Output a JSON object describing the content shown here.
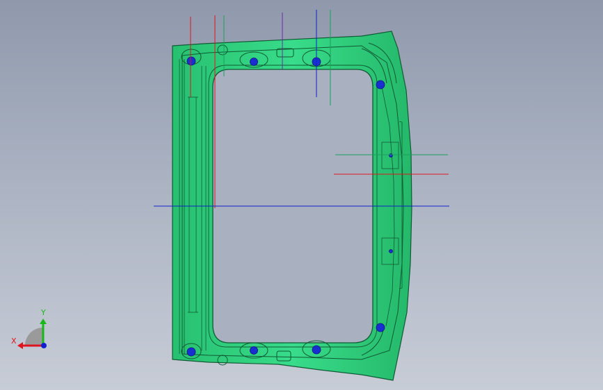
{
  "viewport": {
    "background_top": "#8f99ab",
    "background_bottom": "#c7ccd6"
  },
  "part": {
    "fill_color": "#2fd481",
    "edge_color": "#0f5a32",
    "hole_color": "#1a2fd0"
  },
  "reference_lines": {
    "red": "#e0141e",
    "green": "#1aa05a",
    "blue": "#1020c8",
    "purple": "#6a2aa8"
  },
  "triad": {
    "x_label": "X",
    "y_label": "Y",
    "x_color": "#e0141e",
    "y_color": "#18b818",
    "z_color": "#1020d0"
  }
}
